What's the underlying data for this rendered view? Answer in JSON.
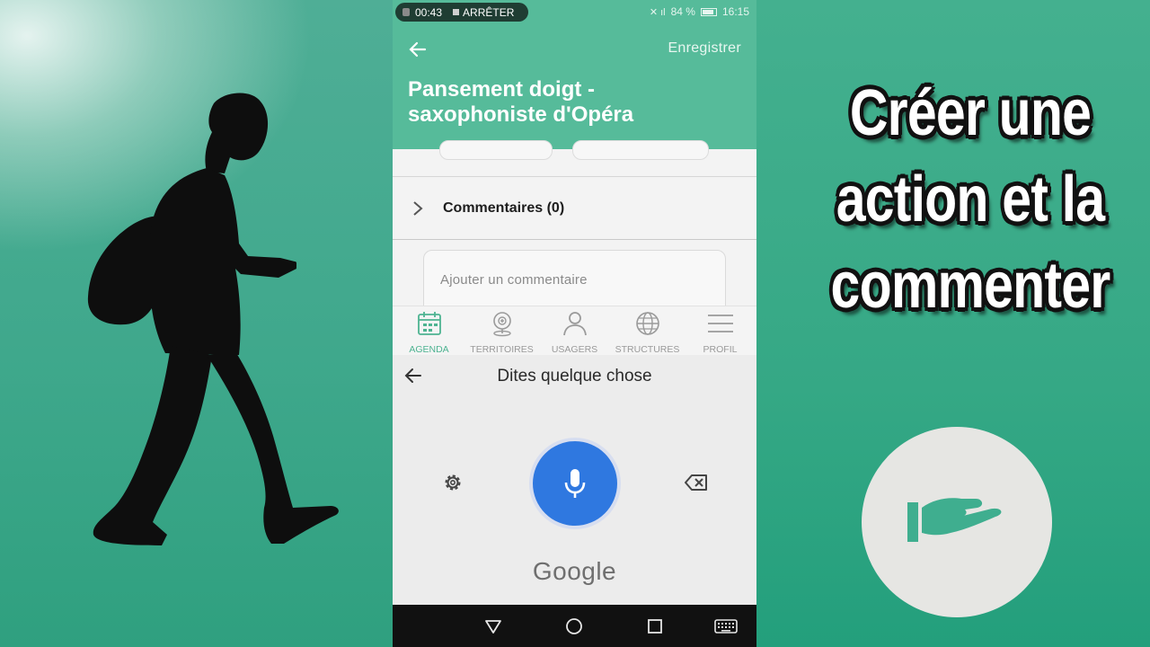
{
  "overlay": {
    "title_lines": [
      "Créer une",
      "action et la",
      "commenter"
    ]
  },
  "status_bar": {
    "recording_time": "00:43",
    "stop_label": "ARRÊTER",
    "battery": "84 %",
    "clock": "16:15"
  },
  "app_bar": {
    "save_label": "Enregistrer",
    "title": "Pansement doigt - saxophoniste d'Opéra"
  },
  "comments": {
    "header": "Commentaires (0)",
    "placeholder": "Ajouter un commentaire"
  },
  "tabs": [
    {
      "label": "AGENDA",
      "icon": "calendar-icon",
      "active": true
    },
    {
      "label": "TERRITOIRES",
      "icon": "map-pin-icon",
      "active": false
    },
    {
      "label": "USAGERS",
      "icon": "user-icon",
      "active": false
    },
    {
      "label": "STRUCTURES",
      "icon": "globe-icon",
      "active": false
    },
    {
      "label": "PROFIL",
      "icon": "menu-icon",
      "active": false
    }
  ],
  "voice_input": {
    "prompt": "Dites quelque chose",
    "brand": "Google"
  },
  "colors": {
    "app_green": "#56bb9a",
    "mic_blue": "#2f78e0",
    "active_tab": "#4db391"
  }
}
